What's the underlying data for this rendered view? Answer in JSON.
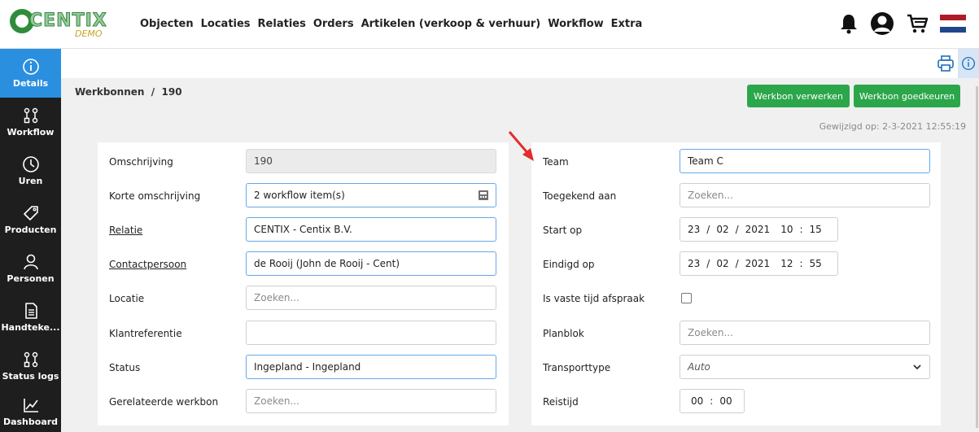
{
  "brand": {
    "name": "CENTIX",
    "tag": "DEMO",
    "color": "#2f8c3a"
  },
  "nav": [
    "Objecten",
    "Locaties",
    "Relaties",
    "Orders",
    "Artikelen (verkoop & verhuur)",
    "Workflow",
    "Extra"
  ],
  "top_icons": [
    "bell-icon",
    "user-icon",
    "cart-icon",
    "dutch-flag-icon"
  ],
  "sidebar": [
    {
      "label": "Details",
      "icon": "info-icon",
      "active": true
    },
    {
      "label": "Workflow",
      "icon": "workflow-icon",
      "active": false
    },
    {
      "label": "Uren",
      "icon": "clock-icon",
      "active": false
    },
    {
      "label": "Producten",
      "icon": "tag-icon",
      "active": false
    },
    {
      "label": "Personen",
      "icon": "person-icon",
      "active": false
    },
    {
      "label": "Handteke...",
      "icon": "document-icon",
      "active": false
    },
    {
      "label": "Status logs",
      "icon": "workflow-icon",
      "active": false
    },
    {
      "label": "Dashboard",
      "icon": "chart-icon",
      "active": false
    }
  ],
  "breadcrumb": "Werkbonnen  /  190",
  "buttons": {
    "process": "Werkbon verwerken",
    "approve": "Werkbon goedkeuren"
  },
  "modified": "Gewijzigd op: 2-3-2021 12:55:19",
  "left_fields": [
    {
      "label": "Omschrijving",
      "value": "190",
      "placeholder": "",
      "state": "disabled",
      "link": false
    },
    {
      "label": "Korte omschrijving",
      "value": "2 workflow item(s)",
      "placeholder": "",
      "state": "focus",
      "link": false
    },
    {
      "label": "Relatie",
      "value": "CENTIX - Centix B.V.",
      "placeholder": "",
      "state": "focus",
      "link": true
    },
    {
      "label": "Contactpersoon",
      "value": "de Rooij (John de Rooij - Cent)",
      "placeholder": "",
      "state": "focus",
      "link": true
    },
    {
      "label": "Locatie",
      "value": "",
      "placeholder": "Zoeken...",
      "state": "normal",
      "link": false
    },
    {
      "label": "Klantreferentie",
      "value": "",
      "placeholder": "",
      "state": "normal",
      "link": false
    },
    {
      "label": "Status",
      "value": "Ingepland - Ingepland",
      "placeholder": "",
      "state": "focus",
      "link": false
    },
    {
      "label": "Gerelateerde werkbon",
      "value": "",
      "placeholder": "Zoeken...",
      "state": "normal",
      "link": false
    }
  ],
  "right_fields": {
    "team": {
      "label": "Team",
      "value": "Team C"
    },
    "assigned": {
      "label": "Toegekend aan",
      "placeholder": "Zoeken..."
    },
    "start": {
      "label": "Start op",
      "day": "23",
      "month": "02",
      "year": "2021",
      "hour": "10",
      "minute": "15"
    },
    "end": {
      "label": "Eindigd op",
      "day": "23",
      "month": "02",
      "year": "2021",
      "hour": "12",
      "minute": "55"
    },
    "fixed": {
      "label": "Is vaste tijd afspraak",
      "checked": false
    },
    "planblok": {
      "label": "Planblok",
      "placeholder": "Zoeken..."
    },
    "transport": {
      "label": "Transporttype",
      "value": "Auto"
    },
    "travel": {
      "label": "Reistijd",
      "hour": "00",
      "minute": "00"
    }
  },
  "sep": {
    "slash": "/",
    "colon": ":"
  },
  "colors": {
    "accent_blue": "#2b8fe0",
    "button_green": "#2ca64a",
    "sidebar_bg": "#1e1e1e",
    "arrow_red": "#e52b2b"
  }
}
